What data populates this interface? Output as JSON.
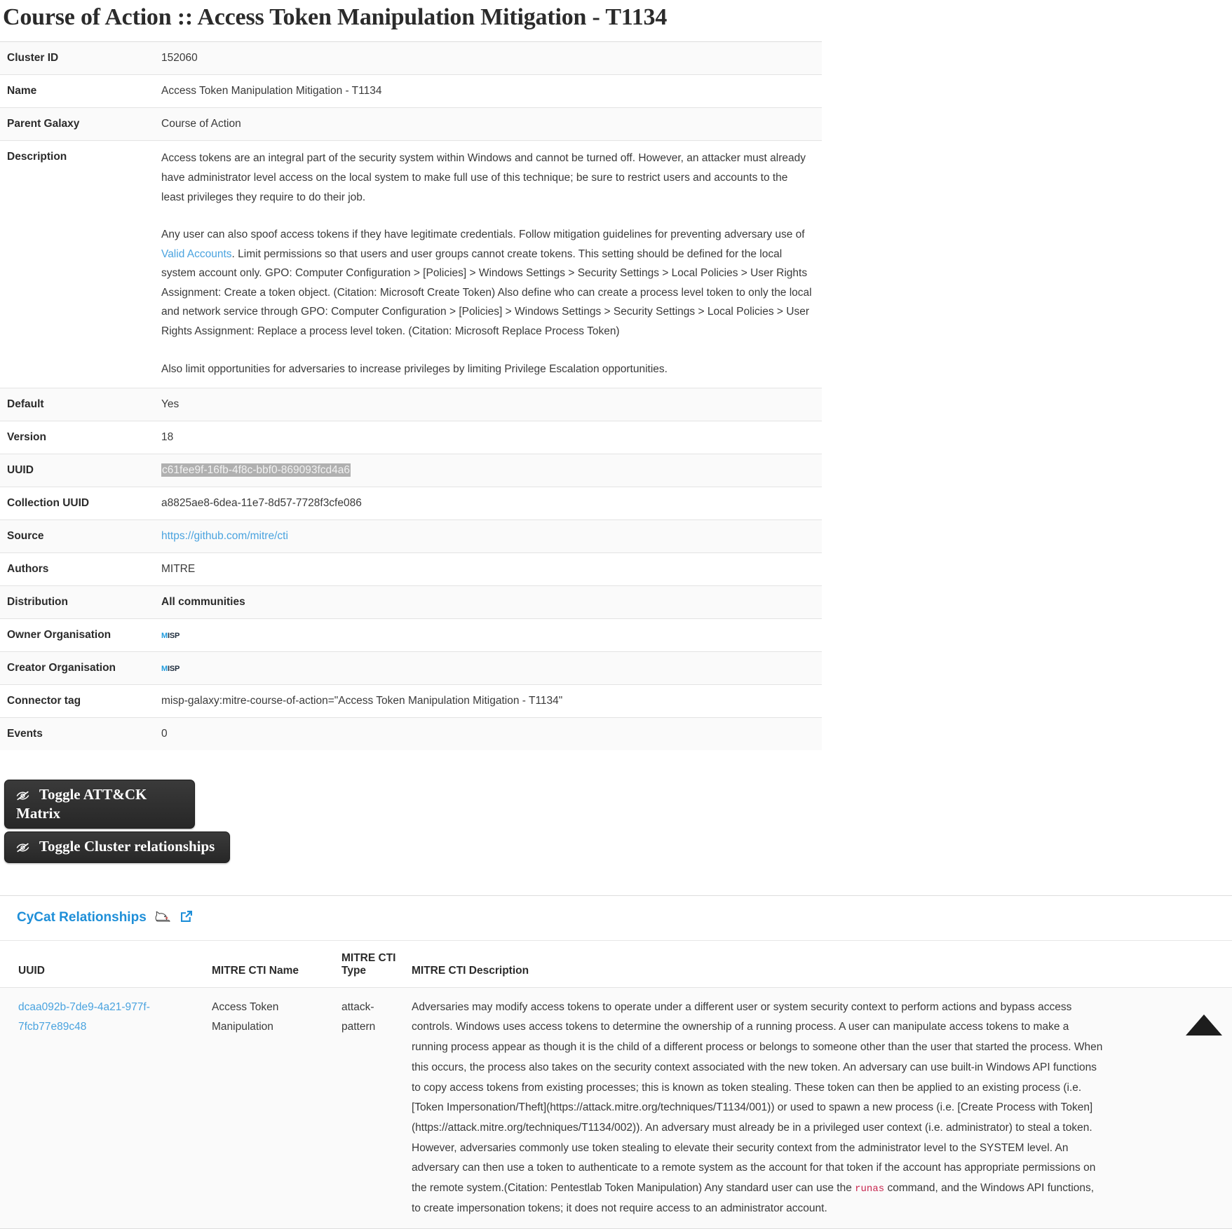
{
  "page": {
    "title": "Course of Action :: Access Token Manipulation Mitigation - T1134"
  },
  "attributes": {
    "cluster_id": {
      "key": "Cluster ID",
      "value": "152060"
    },
    "name": {
      "key": "Name",
      "value": "Access Token Manipulation Mitigation - T1134"
    },
    "parent_galaxy": {
      "key": "Parent Galaxy",
      "value": "Course of Action"
    },
    "description": {
      "key": "Description",
      "paragraph_1": "Access tokens are an integral part of the security system within Windows and cannot be turned off. However, an attacker must already have administrator level access on the local system to make full use of this technique; be sure to restrict users and accounts to the least privileges they require to do their job.",
      "paragraph_2_pre": "Any user can also spoof access tokens if they have legitimate credentials. Follow mitigation guidelines for preventing adversary use of ",
      "paragraph_2_link": "Valid Accounts",
      "paragraph_2_post": ". Limit permissions so that users and user groups cannot create tokens. This setting should be defined for the local system account only. GPO: Computer Configuration > [Policies] > Windows Settings > Security Settings > Local Policies > User Rights Assignment: Create a token object. (Citation: Microsoft Create Token) Also define who can create a process level token to only the local and network service through GPO: Computer Configuration > [Policies] > Windows Settings > Security Settings > Local Policies > User Rights Assignment: Replace a process level token. (Citation: Microsoft Replace Process Token)",
      "paragraph_3": "Also limit opportunities for adversaries to increase privileges by limiting Privilege Escalation opportunities."
    },
    "default": {
      "key": "Default",
      "value": "Yes"
    },
    "version": {
      "key": "Version",
      "value": "18"
    },
    "uuid": {
      "key": "UUID",
      "value": "c61fee9f-16fb-4f8c-bbf0-869093fcd4a6"
    },
    "collection_uuid": {
      "key": "Collection UUID",
      "value": "a8825ae8-6dea-11e7-8d57-7728f3cfe086"
    },
    "source": {
      "key": "Source",
      "value": "https://github.com/mitre/cti"
    },
    "authors": {
      "key": "Authors",
      "value": "MITRE"
    },
    "distribution": {
      "key": "Distribution",
      "value": "All communities"
    },
    "owner_organisation": {
      "key": "Owner Organisation",
      "value": "MISP",
      "logo_first": "M",
      "logo_rest": "ISP"
    },
    "creator_organisation": {
      "key": "Creator Organisation",
      "value": "MISP",
      "logo_first": "M",
      "logo_rest": "ISP"
    },
    "connector_tag": {
      "key": "Connector tag",
      "value": "misp-galaxy:mitre-course-of-action=\"Access Token Manipulation Mitigation - T1134\""
    },
    "events": {
      "key": "Events",
      "value": "0"
    }
  },
  "toggles": {
    "matrix_label": "Toggle ATT&CK Matrix",
    "cluster_label": "Toggle Cluster relationships"
  },
  "cycat": {
    "title": "CyCat Relationships",
    "columns": {
      "uuid": "UUID",
      "name": "MITRE CTI Name",
      "type_line1": "MITRE CTI",
      "type_line2": "Type",
      "description": "MITRE CTI Description"
    },
    "rows": [
      {
        "uuid": "dcaa092b-7de9-4a21-977f-7fcb77e89c48",
        "name": "Access Token Manipulation",
        "type": "attack-pattern",
        "description_pre": "Adversaries may modify access tokens to operate under a different user or system security context to perform actions and bypass access controls. Windows uses access tokens to determine the ownership of a running process. A user can manipulate access tokens to make a running process appear as though it is the child of a different process or belongs to someone other than the user that started the process. When this occurs, the process also takes on the security context associated with the new token. An adversary can use built-in Windows API functions to copy access tokens from existing processes; this is known as token stealing. These token can then be applied to an existing process (i.e. [Token Impersonation/Theft](https://attack.mitre.org/techniques/T1134/001)) or used to spawn a new process (i.e. [Create Process with Token](https://attack.mitre.org/techniques/T1134/002)). An adversary must already be in a privileged user context (i.e. administrator) to steal a token. However, adversaries commonly use token stealing to elevate their security context from the administrator level to the SYSTEM level. An adversary can then use a token to authenticate to a remote system as the account for that token if the account has appropriate permissions on the remote system.(Citation: Pentestlab Token Manipulation) Any standard user can use the ",
        "description_code": "runas",
        "description_post": " command, and the Windows API functions, to create impersonation tokens; it does not require access to an administrator account."
      }
    ]
  },
  "colors": {
    "link": "#4aa3df",
    "cycat_blue": "#1f8fd8",
    "code_red": "#c7254e",
    "button_dark": "#2f2f2f",
    "selection_gray": "#b0b0b0"
  }
}
